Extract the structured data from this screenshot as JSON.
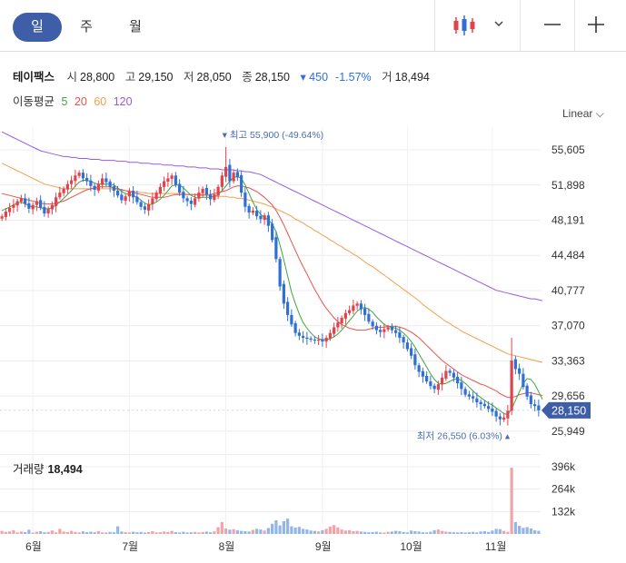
{
  "tabs": [
    {
      "label": "일",
      "active": true
    },
    {
      "label": "주",
      "active": false
    },
    {
      "label": "월",
      "active": false
    }
  ],
  "icons": {
    "chart_type": "candlestick-icon",
    "caret": "chevron-down-icon",
    "zoom_out": "minus-icon",
    "zoom_in": "plus-icon"
  },
  "stock": {
    "name": "테이팩스",
    "open_label": "시",
    "open": "28,800",
    "high_label": "고",
    "high": "29,150",
    "low_label": "저",
    "low": "28,050",
    "close_label": "종",
    "close": "28,150",
    "change": "▾ 450",
    "change_pct": "-1.57%",
    "volume_label": "거",
    "volume": "18,494"
  },
  "ma_legend": {
    "label": "이동평균",
    "items": [
      {
        "period": "5",
        "color": "#3fa63f"
      },
      {
        "period": "20",
        "color": "#e8524b"
      },
      {
        "period": "60",
        "color": "#f0a04b"
      },
      {
        "period": "120",
        "color": "#9b59e0"
      }
    ]
  },
  "scale_label": "Linear ⌵",
  "colors": {
    "up": "#e0434b",
    "down": "#2f6fd6",
    "last_price_bg": "#3f5ea8"
  },
  "chart_data": {
    "type": "candlestick",
    "y_ticks": [
      "55,605",
      "51,898",
      "48,191",
      "44,484",
      "40,777",
      "37,070",
      "33,363",
      "29,656",
      "25,949"
    ],
    "y_tick_values": [
      55605,
      51898,
      48191,
      44484,
      40777,
      37070,
      33363,
      29656,
      25949
    ],
    "x_labels": [
      "6월",
      "7월",
      "8월",
      "9월",
      "10월",
      "11월"
    ],
    "max_label": "최고 55,900 (-49.64%)",
    "min_label": "최저 26,550 (6.03%)",
    "max_value": 55900,
    "min_value": 26550,
    "last_price": "28,150",
    "last_value": 28150,
    "closes": [
      48600,
      49100,
      49500,
      49800,
      50200,
      50500,
      49900,
      49400,
      49800,
      50200,
      49500,
      48900,
      49400,
      49800,
      50600,
      51100,
      51500,
      52000,
      52400,
      52900,
      53200,
      52600,
      52300,
      51800,
      51400,
      52000,
      52600,
      52200,
      51700,
      51300,
      50800,
      50300,
      50700,
      51200,
      50600,
      50100,
      49600,
      49300,
      49900,
      50500,
      51100,
      51700,
      52300,
      52600,
      52900,
      51900,
      51100,
      50500,
      50200,
      49900,
      50500,
      51100,
      51500,
      50900,
      50400,
      50900,
      51700,
      52900,
      53800,
      52300,
      53200,
      52700,
      51100,
      49600,
      49000,
      49200,
      48600,
      48300,
      48700,
      47600,
      46100,
      44100,
      41200,
      39400,
      38200,
      37200,
      36300,
      36000,
      35800,
      35700,
      35600,
      35500,
      35600,
      35400,
      35800,
      36300,
      36900,
      37400,
      37900,
      38400,
      38700,
      39200,
      39400,
      38800,
      38200,
      37500,
      37000,
      36600,
      36400,
      36700,
      36900,
      36600,
      36300,
      35800,
      35300,
      34600,
      33900,
      32900,
      32200,
      31700,
      31200,
      30700,
      30400,
      30900,
      31600,
      32300,
      32100,
      31600,
      31000,
      30400,
      29800,
      29600,
      29400,
      29000,
      28800,
      28600,
      28300,
      28000,
      27500,
      27200,
      27400,
      28100,
      33400,
      32500,
      32000,
      30600,
      29600,
      28800,
      28600,
      28150
    ],
    "ma5": [
      49200,
      49400,
      49600,
      49800,
      50000,
      50100,
      49900,
      49700,
      49600,
      49600,
      49500,
      49400,
      49400,
      49500,
      49800,
      50100,
      50500,
      50900,
      51300,
      51800,
      52200,
      52400,
      52400,
      52300,
      52100,
      52000,
      52000,
      52000,
      52000,
      51900,
      51600,
      51200,
      51000,
      50900,
      50800,
      50600,
      50300,
      50000,
      49800,
      49900,
      50100,
      50400,
      50800,
      51300,
      51800,
      51900,
      51900,
      51600,
      51200,
      50800,
      50600,
      50500,
      50600,
      50600,
      50600,
      50700,
      50900,
      51300,
      51800,
      52300,
      52700,
      52800,
      52600,
      51900,
      51000,
      50100,
      49300,
      48800,
      48500,
      48200,
      47800,
      47000,
      45600,
      44000,
      42300,
      40600,
      39400,
      38300,
      37400,
      36800,
      36300,
      35900,
      35700,
      35600,
      35600,
      35700,
      35900,
      36200,
      36600,
      37100,
      37600,
      38100,
      38600,
      38900,
      39000,
      38800,
      38500,
      38000,
      37600,
      37200,
      37000,
      36900,
      36800,
      36600,
      36300,
      35900,
      35400,
      34800,
      34100,
      33400,
      32700,
      32000,
      31400,
      31000,
      30900,
      31000,
      31200,
      31400,
      31500,
      31300,
      31000,
      30600,
      30200,
      29800,
      29500,
      29200,
      28900,
      28700,
      28400,
      28100,
      27800,
      27700,
      28300,
      29200,
      30100,
      31000,
      31500,
      31400,
      30900,
      30100,
      29300
    ],
    "ma20": [
      51000,
      50900,
      50800,
      50700,
      50600,
      50500,
      50400,
      50300,
      50200,
      50100,
      50000,
      49900,
      49900,
      49900,
      50000,
      50100,
      50200,
      50400,
      50600,
      50800,
      51000,
      51200,
      51400,
      51500,
      51600,
      51700,
      51700,
      51700,
      51700,
      51600,
      51500,
      51400,
      51300,
      51200,
      51100,
      51000,
      50900,
      50800,
      50700,
      50600,
      50600,
      50600,
      50600,
      50700,
      50800,
      50900,
      50900,
      50900,
      50900,
      50900,
      50900,
      50900,
      50900,
      50900,
      50900,
      51000,
      51100,
      51200,
      51300,
      51500,
      51700,
      51800,
      51800,
      51700,
      51600,
      51400,
      51200,
      50900,
      50600,
      50200,
      49800,
      49200,
      48500,
      47700,
      46800,
      45900,
      45000,
      44100,
      43300,
      42500,
      41700,
      40900,
      40200,
      39500,
      38900,
      38400,
      37900,
      37500,
      37200,
      37000,
      36800,
      36700,
      36600,
      36600,
      36600,
      36700,
      36800,
      36900,
      36900,
      36900,
      37000,
      37000,
      37000,
      36900,
      36800,
      36600,
      36400,
      36100,
      35800,
      35400,
      35000,
      34600,
      34200,
      33800,
      33400,
      33100,
      32800,
      32500,
      32200,
      31900,
      31700,
      31500,
      31300,
      31100,
      30900,
      30800,
      30600,
      30400,
      30200,
      29900,
      29700,
      29500,
      29500,
      29600,
      29800,
      29900,
      30000,
      30000,
      29900,
      29800,
      29700
    ],
    "ma60": [
      54200,
      54000,
      53800,
      53600,
      53400,
      53200,
      53000,
      52800,
      52600,
      52400,
      52200,
      52000,
      51900,
      51800,
      51700,
      51600,
      51500,
      51500,
      51500,
      51500,
      51500,
      51500,
      51500,
      51500,
      51500,
      51500,
      51500,
      51500,
      51500,
      51500,
      51400,
      51400,
      51300,
      51300,
      51200,
      51200,
      51100,
      51100,
      51000,
      51000,
      51000,
      51000,
      51000,
      51000,
      51000,
      51000,
      51000,
      51000,
      50900,
      50900,
      50900,
      50800,
      50800,
      50800,
      50700,
      50700,
      50700,
      50700,
      50700,
      50600,
      50600,
      50500,
      50500,
      50400,
      50300,
      50200,
      50100,
      50000,
      49900,
      49700,
      49600,
      49400,
      49200,
      49000,
      48800,
      48600,
      48300,
      48100,
      47900,
      47600,
      47400,
      47100,
      46900,
      46600,
      46400,
      46100,
      45900,
      45600,
      45400,
      45100,
      44900,
      44600,
      44400,
      44100,
      43800,
      43500,
      43300,
      43000,
      42700,
      42400,
      42100,
      41800,
      41500,
      41200,
      40900,
      40600,
      40300,
      40000,
      39700,
      39300,
      39000,
      38700,
      38400,
      38100,
      37800,
      37500,
      37300,
      37000,
      36800,
      36500,
      36300,
      36100,
      35900,
      35700,
      35500,
      35300,
      35100,
      34900,
      34700,
      34500,
      34300,
      34100,
      34000,
      33900,
      33800,
      33700,
      33600,
      33500,
      33400,
      33300,
      33200
    ],
    "ma120": [
      57500,
      57300,
      57100,
      56900,
      56700,
      56500,
      56300,
      56100,
      55900,
      55700,
      55500,
      55400,
      55300,
      55200,
      55100,
      55000,
      54900,
      54900,
      54800,
      54800,
      54700,
      54700,
      54700,
      54600,
      54600,
      54600,
      54500,
      54500,
      54500,
      54500,
      54400,
      54400,
      54400,
      54300,
      54300,
      54300,
      54200,
      54200,
      54200,
      54100,
      54100,
      54100,
      54000,
      54000,
      54000,
      53900,
      53900,
      53900,
      53800,
      53800,
      53800,
      53700,
      53700,
      53700,
      53600,
      53600,
      53600,
      53500,
      53500,
      53500,
      53500,
      53400,
      53400,
      53300,
      53300,
      53200,
      53100,
      53000,
      52800,
      52600,
      52400,
      52200,
      52000,
      51800,
      51600,
      51400,
      51200,
      51000,
      50800,
      50600,
      50400,
      50200,
      50000,
      49800,
      49600,
      49400,
      49200,
      49000,
      48800,
      48600,
      48400,
      48200,
      48000,
      47800,
      47600,
      47400,
      47200,
      47000,
      46800,
      46600,
      46400,
      46200,
      46000,
      45800,
      45600,
      45400,
      45200,
      45000,
      44800,
      44600,
      44400,
      44200,
      44000,
      43800,
      43600,
      43400,
      43200,
      43000,
      42800,
      42600,
      42400,
      42200,
      42000,
      41800,
      41600,
      41400,
      41200,
      41000,
      40800,
      40700,
      40600,
      40500,
      40400,
      40300,
      40200,
      40100,
      40000,
      39900,
      39900,
      39800,
      39700
    ],
    "volume_label": "거래량",
    "volume_value": "18,494",
    "volume_ticks": [
      "396k",
      "264k",
      "132k"
    ],
    "volume_tick_values": [
      396000,
      264000,
      132000
    ],
    "volumes": [
      18000,
      12000,
      15000,
      22000,
      9000,
      14000,
      11000,
      25000,
      8000,
      13000,
      16000,
      10000,
      12000,
      20000,
      9000,
      30000,
      14000,
      11000,
      18000,
      12000,
      9000,
      15000,
      11000,
      13000,
      10000,
      17000,
      9000,
      8000,
      12000,
      10000,
      45000,
      14000,
      11000,
      9000,
      13000,
      10000,
      12000,
      8000,
      11000,
      16000,
      9000,
      10000,
      14000,
      12000,
      18000,
      11000,
      9000,
      13000,
      8000,
      10000,
      12000,
      9000,
      11000,
      14000,
      10000,
      15000,
      40000,
      70000,
      32000,
      25000,
      28000,
      22000,
      18000,
      16000,
      14000,
      24000,
      30000,
      26000,
      20000,
      35000,
      60000,
      80000,
      50000,
      75000,
      90000,
      45000,
      38000,
      42000,
      30000,
      26000,
      20000,
      18000,
      15000,
      22000,
      30000,
      44000,
      52000,
      38000,
      26000,
      20000,
      22000,
      16000,
      18000,
      14000,
      12000,
      10000,
      11000,
      13000,
      9000,
      8000,
      12000,
      14000,
      18000,
      16000,
      12000,
      9000,
      20000,
      16000,
      14000,
      10000,
      9000,
      13000,
      22000,
      26000,
      18000,
      14000,
      12000,
      10000,
      9000,
      11000,
      8000,
      10000,
      12000,
      9000,
      14000,
      16000,
      12000,
      20000,
      30000,
      28000,
      18000,
      12000,
      390000,
      70000,
      48000,
      36000,
      40000,
      32000,
      22000,
      18494
    ]
  }
}
